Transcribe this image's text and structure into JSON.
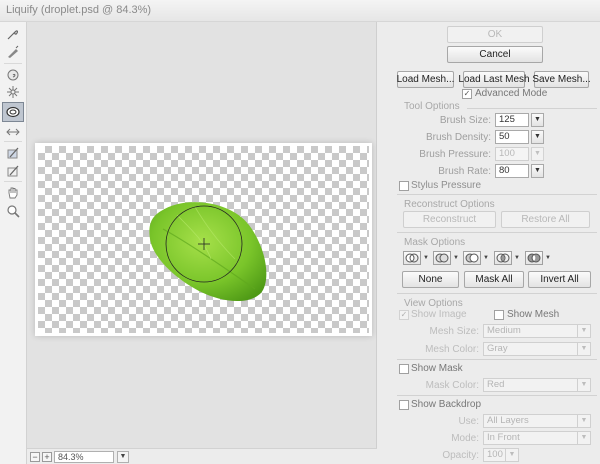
{
  "window": {
    "title": "Liquify (droplet.psd @ 84.3%)"
  },
  "tools": [
    {
      "name": "forward-warp-tool-icon"
    },
    {
      "name": "reconstruct-tool-icon"
    },
    {
      "name": "twirl-clockwise-tool-icon"
    },
    {
      "name": "pucker-tool-icon"
    },
    {
      "name": "bloat-tool-icon"
    },
    {
      "name": "push-left-tool-icon"
    },
    {
      "name": "freeze-mask-tool-icon"
    },
    {
      "name": "thaw-mask-tool-icon"
    },
    {
      "name": "hand-tool-icon"
    },
    {
      "name": "zoom-tool-icon"
    }
  ],
  "status": {
    "zoom": "84.3%",
    "minus": "−",
    "plus": "+",
    "dropdown": "▼"
  },
  "buttons": {
    "ok": "OK",
    "cancel": "Cancel",
    "load_mesh": "Load Mesh...",
    "load_last_mesh": "Load Last Mesh",
    "save_mesh": "Save Mesh...",
    "reconstruct": "Reconstruct",
    "restore_all": "Restore All",
    "none": "None",
    "mask_all": "Mask All",
    "invert_all": "Invert All"
  },
  "advanced_mode": {
    "label": "Advanced Mode",
    "checked": true,
    "mark": "✓"
  },
  "tool_options": {
    "title": "Tool Options",
    "brush_size": {
      "label": "Brush Size:",
      "value": "125"
    },
    "brush_density": {
      "label": "Brush Density:",
      "value": "50"
    },
    "brush_pressure": {
      "label": "Brush Pressure:",
      "value": "100"
    },
    "brush_rate": {
      "label": "Brush Rate:",
      "value": "80"
    },
    "stylus_pressure": {
      "label": "Stylus Pressure",
      "checked": false
    }
  },
  "reconstruct_options": {
    "title": "Reconstruct Options"
  },
  "mask_options": {
    "title": "Mask Options"
  },
  "view_options": {
    "title": "View Options",
    "show_image": {
      "label": "Show Image",
      "checked": true,
      "mark": "✓"
    },
    "show_mesh": {
      "label": "Show Mesh",
      "checked": false
    },
    "mesh_size": {
      "label": "Mesh Size:",
      "value": "Medium"
    },
    "mesh_color": {
      "label": "Mesh Color:",
      "value": "Gray"
    },
    "show_mask": {
      "label": "Show Mask",
      "checked": false
    },
    "mask_color": {
      "label": "Mask Color:",
      "value": "Red"
    },
    "show_backdrop": {
      "label": "Show Backdrop",
      "checked": false
    },
    "use": {
      "label": "Use:",
      "value": "All Layers"
    },
    "mode": {
      "label": "Mode:",
      "value": "In Front"
    },
    "opacity": {
      "label": "Opacity:",
      "value": "100"
    }
  },
  "colors": {
    "leaf": "#7ac52a",
    "leaf_dark": "#4f9a16",
    "accent_panel": "#ececec"
  }
}
